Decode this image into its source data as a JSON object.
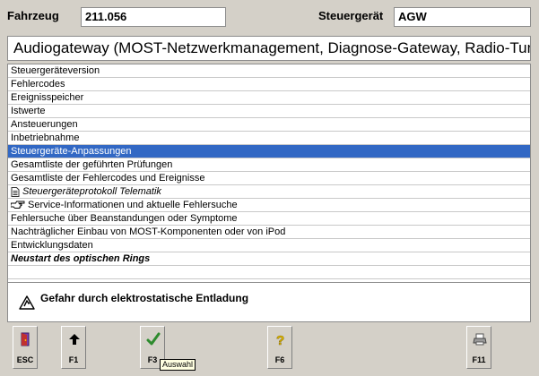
{
  "header": {
    "vehicle_label": "Fahrzeug",
    "vehicle_value": "211.056",
    "ecu_label": "Steuergerät",
    "ecu_value": "AGW"
  },
  "title": "Audiogateway (MOST-Netzwerkmanagement, Diagnose-Gateway, Radio-Tuner)",
  "menu": [
    {
      "label": "Steuergeräteversion"
    },
    {
      "label": "Fehlercodes"
    },
    {
      "label": "Ereignisspeicher"
    },
    {
      "label": "Istwerte"
    },
    {
      "label": "Ansteuerungen"
    },
    {
      "label": "Inbetriebnahme"
    },
    {
      "label": "Steuergeräte-Anpassungen",
      "selected": true
    },
    {
      "label": "Gesamtliste der geführten Prüfungen"
    },
    {
      "label": "Gesamtliste der Fehlercodes und Ereignisse"
    },
    {
      "label": "Steuergeräteprotokoll Telematik",
      "icon": "document-icon",
      "style": "italic"
    },
    {
      "label": "Service-Informationen und aktuelle Fehlersuche",
      "icon": "pointing-hand-icon"
    },
    {
      "label": "Fehlersuche über Beanstandungen oder Symptome"
    },
    {
      "label": "Nachträglicher Einbau von MOST-Komponenten oder von iPod"
    },
    {
      "label": "Entwicklungsdaten"
    },
    {
      "label": "Neustart des optischen Rings",
      "style": "bold-italic"
    }
  ],
  "warning": {
    "text": "Gefahr durch elektrostatische Entladung",
    "icon": "esd-warning-icon"
  },
  "toolbar": [
    {
      "key": "ESC",
      "icon": "exit-door-icon"
    },
    {
      "key": "F1",
      "icon": "arrow-up-icon"
    },
    {
      "key": "F3",
      "icon": "checkmark-icon"
    },
    {
      "key": "F6",
      "icon": "help-question-icon"
    },
    {
      "key": "F11",
      "icon": "printer-icon"
    }
  ],
  "tooltip": "Auswahl",
  "colors": {
    "background": "#d4d0c8",
    "selection": "#3268c4",
    "checkmark": "#2e8b2e",
    "help": "#e8c000"
  }
}
